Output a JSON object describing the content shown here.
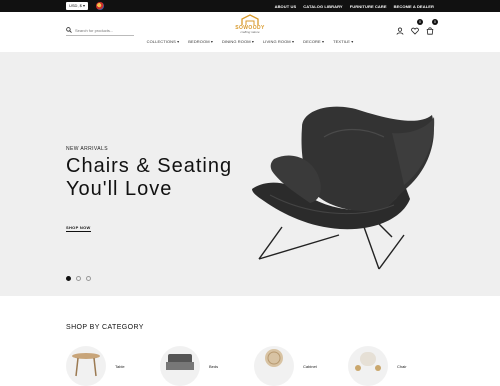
{
  "topbar": {
    "currency": "USD, $",
    "links": [
      "ABOUT US",
      "CATALOG LIBRARY",
      "FURNITURE CARE",
      "BECOME A DEALER"
    ]
  },
  "header": {
    "search_placeholder": "Search for products...",
    "logo": {
      "brand": "SOWOODY",
      "tagline": "crafting nature"
    },
    "cart_count": "0",
    "wishlist_count": "0",
    "icons": [
      "user-icon",
      "heart-icon",
      "cart-icon",
      "search-icon"
    ]
  },
  "nav": {
    "items": [
      "COLLECTIONS",
      "BEDROOM",
      "DINING ROOM",
      "LIVING ROOM",
      "DECORE",
      "TEXTILE"
    ]
  },
  "hero": {
    "eyebrow": "NEW ARRIVALS",
    "title_line1": "Chairs & Seating",
    "title_line2": "You'll Love",
    "cta": "SHOP NOW",
    "slides": 3,
    "active_slide": 1
  },
  "categories": {
    "title": "SHOP BY CATEGORY",
    "items": [
      {
        "label": "Table"
      },
      {
        "label": "Beds"
      },
      {
        "label": "Cabinet"
      },
      {
        "label": "Chair"
      }
    ]
  },
  "colors": {
    "topbar": "#111111",
    "hero_bg": "#efefef",
    "logo_accent": "#d99a2b",
    "chair": "#2b2b2b"
  }
}
